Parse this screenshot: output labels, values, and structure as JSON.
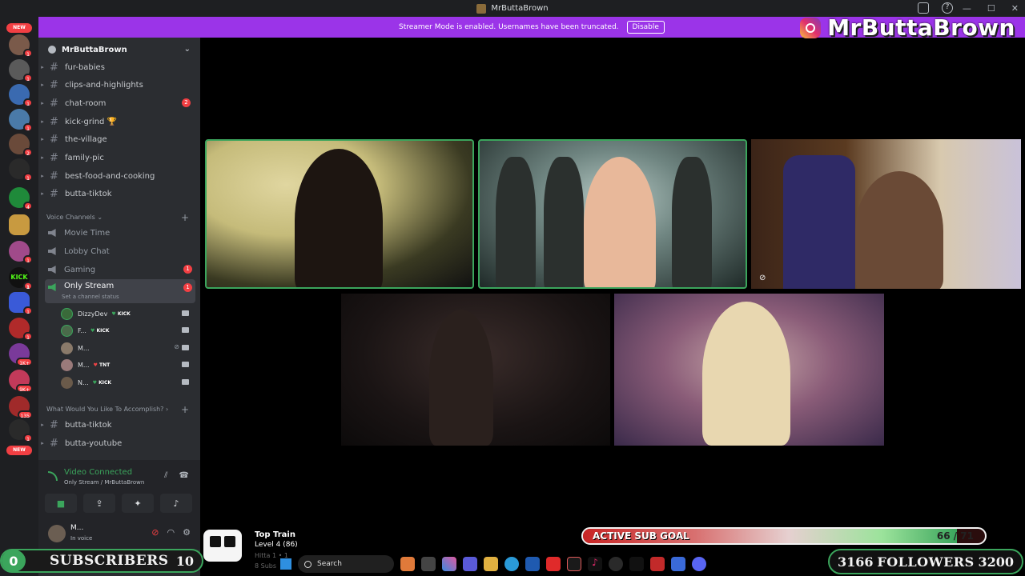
{
  "window": {
    "title": "MrButtaBrown"
  },
  "banner": {
    "text": "Streamer Mode is enabled. Usernames have been truncated.",
    "button": "Disable"
  },
  "overlay": {
    "instagram_handle": "MrButtaBrown"
  },
  "server_rail": {
    "new_top": "NEW",
    "new_bottom": "NEW",
    "badges": [
      "1",
      "1",
      "1",
      "1",
      "2",
      "1",
      "4",
      "1",
      "1",
      "1",
      "1",
      "1",
      "1",
      "1K+",
      "9K+",
      "135"
    ]
  },
  "server": {
    "name": "MrButtaBrown"
  },
  "channels_top": [
    {
      "label": "fur-babies"
    },
    {
      "label": "clips-and-highlights"
    },
    {
      "label": "chat-room",
      "count": "2"
    },
    {
      "label": "kick-grind 🏆"
    },
    {
      "label": "the-village"
    },
    {
      "label": "family-pic"
    },
    {
      "label": "best-food-and-cooking"
    },
    {
      "label": "butta-tiktok"
    }
  ],
  "voice_category": {
    "label": "Voice Channels"
  },
  "voice_channels": [
    {
      "label": "Movie Time"
    },
    {
      "label": "Lobby Chat"
    },
    {
      "label": "Gaming",
      "count": "1"
    }
  ],
  "active_voice": {
    "label": "Only Stream",
    "count": "1",
    "status": "Set a channel status"
  },
  "voice_users": [
    {
      "name": "DizzyDev",
      "tag": "KICK",
      "heart": "green"
    },
    {
      "name": "F...",
      "tag": "KICK",
      "heart": "green"
    },
    {
      "name": "M...",
      "tag": "",
      "heart": ""
    },
    {
      "name": "M...",
      "tag": "TNT",
      "heart": "red"
    },
    {
      "name": "N...",
      "tag": "KICK",
      "heart": "green"
    }
  ],
  "category2": {
    "label": "What Would You Like To Accomplish?"
  },
  "channels_bottom": [
    {
      "label": "butta-tiktok"
    },
    {
      "label": "butta-youtube"
    }
  ],
  "voice_panel": {
    "title": "Video Connected",
    "subtitle": "Only Stream / MrButtaBrown"
  },
  "user_panel": {
    "name": "M...",
    "status": "In voice"
  },
  "stream": {
    "subscribers_label": "SUBSCRIBERS",
    "subscribers_current": "0",
    "subscribers_goal": "10",
    "top_train_title": "Top Train",
    "top_train_level": "Level 4  (86)",
    "top_train_ghost": "Hitta 1 • 1",
    "top_train_ghost2": "8 Subs",
    "sub_goal_label": "ACTIVE SUB GOAL",
    "sub_goal_count": "66 / 71",
    "sub_goal_fraction": 0.93,
    "followers_current": "3166",
    "followers_label": "FOLLOWERS",
    "followers_goal": "3200"
  },
  "taskbar": {
    "search_placeholder": "Search"
  }
}
